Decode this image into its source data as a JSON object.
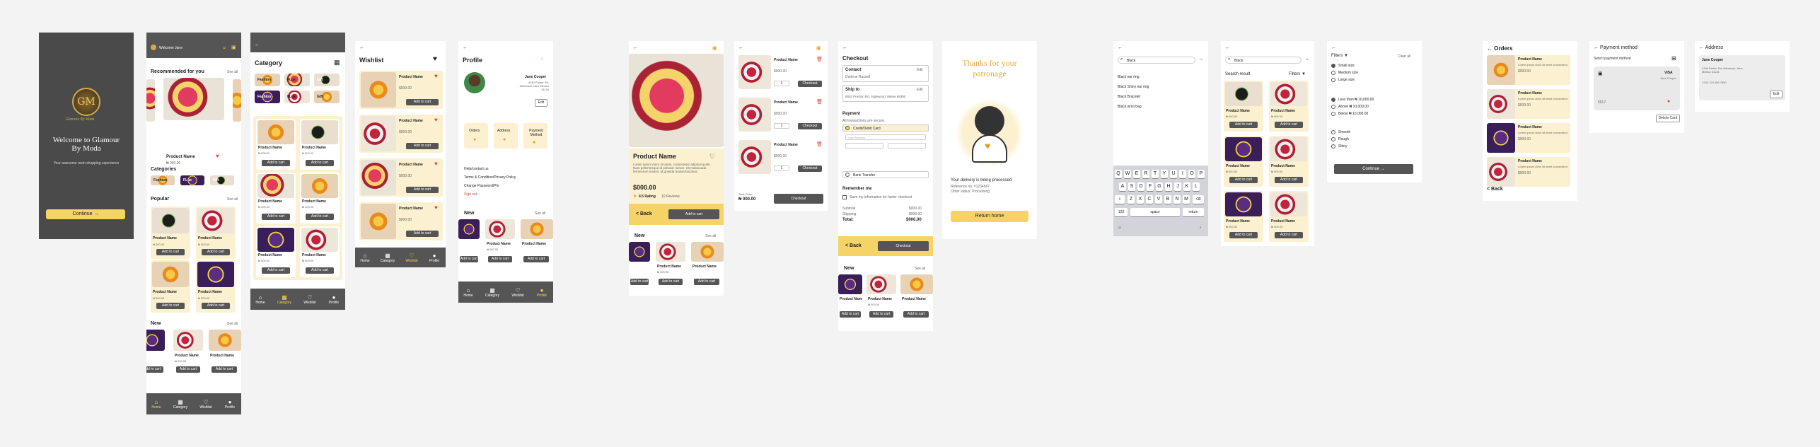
{
  "splash": {
    "logo": "GM",
    "brand": "Glamour By Moda",
    "welcome": "Welcome to Glamour By Moda",
    "sub": "Your awesome resin shopping experience",
    "continue": "Continue"
  },
  "home": {
    "greet": "Welcome Jane",
    "recommended": "Recommended for you",
    "see_all": "See all",
    "categories": "Categories",
    "cat_items": [
      "Fashion",
      "FLux",
      "Gift"
    ],
    "popular": "Popular",
    "new": "New",
    "product": "Product Name",
    "price": "₦ 000.00",
    "add": "Add to cart"
  },
  "category": {
    "title": "Category",
    "cats": [
      "Fashion",
      "FLux",
      "Gift",
      "Fashion",
      "FLux",
      "Gift"
    ],
    "product": "Product Name",
    "price": "₦ 000.00",
    "add": "Add to cart"
  },
  "wishlist": {
    "title": "Wishlist",
    "product": "Product Name",
    "price": "$000.00",
    "add": "Add to cart"
  },
  "nav": {
    "home": "Home",
    "category": "Category",
    "wishlist": "Wishlist",
    "profile": "Profile"
  },
  "profile": {
    "title": "Profile",
    "name": "Jane Cooper",
    "address": "4140 Parker Rd, Allentown, New Mexico 31134",
    "edit": "Edit",
    "orders": "Orders",
    "addr": "Address",
    "payment": "Payment Method",
    "help": "Help/contact us",
    "terms": "Terms & Condition/Privacy Policy",
    "change": "Change Password/Pin",
    "signout": "Sign out",
    "new": "New",
    "see_all": "See all",
    "product": "Product Name",
    "price": "₦ 000.00",
    "add": "Add to cart"
  },
  "detail": {
    "name": "Product Name",
    "desc": "Lorem ipsum dolor sit amet, consectetur adipiscing elit. Nam pellentesque id pulvinar rutrum. Sit malesuada fermentum massa. Id gravida massa faucibus.",
    "price": "$000.00",
    "rating": "4.5 Rating",
    "reviews": "10 Reviews",
    "back": "< Back",
    "add": "Add to cart",
    "new": "New",
    "see_all": "See all",
    "product": "Product Name",
    "price2": "₦ 000.00"
  },
  "cart": {
    "product": "Product Name",
    "price": "$000.00",
    "qty": "1",
    "checkout": "Checkout",
    "total_label": "Total Order",
    "total": "₦ 000.00"
  },
  "checkout": {
    "title": "Checkout",
    "contact": "Contact",
    "contact_val": "Darlene Russell",
    "ship": "Ship to",
    "ship_val": "8502 Preston Rd. Inglewood, Maine 98380",
    "edit": "Edit",
    "payment": "Payment",
    "payment_sub": "All transactions are secure.",
    "credit": "Credit/Debit Card",
    "bank": "Bank Transfer",
    "card_placeholder": "Card Number",
    "remember": "Remember me",
    "remember_sub": "Save my information for faster checkout",
    "subtotal": "Subtotal",
    "subtotal_val": "$000.00",
    "shipping": "Shipping",
    "shipping_val": "$000.00",
    "total": "Total:",
    "total_val": "$000.00",
    "back": "< Back",
    "checkout_btn": "Checkout",
    "new": "New",
    "see_all": "See all",
    "product": "Product Name",
    "price": "₦ 000.00",
    "add": "Add to cart"
  },
  "thanks": {
    "title": "Thanks for your patronage",
    "line1": "Your delivery is being processed",
    "line2": "Reference no: #1234567",
    "line3": "Order status: Processing",
    "btn": "Return home"
  },
  "search": {
    "placeholder": "Black",
    "items": [
      "Black ear ring",
      "Black Shiny ear ring",
      "Black Bracelet",
      "Black wrist bag"
    ],
    "keys1": [
      "Q",
      "W",
      "E",
      "R",
      "T",
      "Y",
      "U",
      "I",
      "O",
      "P"
    ],
    "keys2": [
      "A",
      "S",
      "D",
      "F",
      "G",
      "H",
      "J",
      "K",
      "L"
    ],
    "keys3": [
      "Z",
      "X",
      "C",
      "V",
      "B",
      "N",
      "M"
    ],
    "k123": "123",
    "space": "space",
    "return": "return"
  },
  "results": {
    "placeholder": "Black",
    "title": "Search result",
    "filters": "Filters",
    "product": "Product Name",
    "price": "₦ 000.00",
    "add": "Add to cart"
  },
  "filter": {
    "title": "Filters",
    "clear": "Clear all",
    "sizes": [
      "Small size",
      "Medium size",
      "Large size"
    ],
    "prices": [
      "Less than ₦ 10,000.00",
      "Above ₦ 10,000.00",
      "Below ₦ 10,000.00"
    ],
    "texture": [
      "Smooth",
      "Rough",
      "Shiny"
    ],
    "btn": "Continue"
  },
  "orders": {
    "title": "Orders",
    "product": "Product Name",
    "sub": "Lorem ipsum dolor sit amet consectetur",
    "price": "$000.00",
    "back": "< Back"
  },
  "payment": {
    "title": "Payment method",
    "sub": "Select payment method",
    "visa": "VISA",
    "holder": "Jane Cooper",
    "num": "5917",
    "brand": "Master",
    "delete": "Delete Card"
  },
  "address": {
    "title": "Address",
    "name": "Jane Cooper",
    "addr": "4140 Parker Rd, Allentown, New Mexico 31134",
    "phone": "+234 123 456 7890",
    "edit": "Edit"
  },
  "colors": {
    "accent": "#f6d367",
    "dark": "#555555",
    "heart": "#e0453d",
    "cream": "#fbf0cf"
  }
}
